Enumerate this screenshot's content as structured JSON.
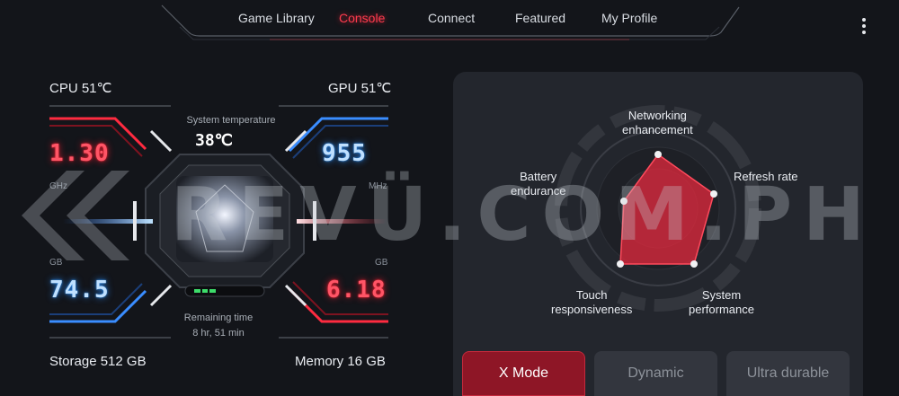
{
  "nav": {
    "tabs": [
      {
        "label": "Game Library",
        "active": false
      },
      {
        "label": "Console",
        "active": true
      },
      {
        "label": "Connect",
        "active": false
      },
      {
        "label": "Featured",
        "active": false
      },
      {
        "label": "My Profile",
        "active": false
      }
    ],
    "menu_icon": "more-vertical-icon"
  },
  "dashboard": {
    "cpu_label": "CPU  51℃",
    "gpu_label": "GPU  51℃",
    "system_temp_label": "System temperature",
    "system_temp_value": "38℃",
    "cpu_freq": "1.30",
    "cpu_freq_unit": "GHz",
    "gpu_freq": "955",
    "gpu_freq_unit": "MHz",
    "storage_used": "74.5",
    "storage_unit": "GB",
    "memory_used": "6.18",
    "memory_unit": "GB",
    "remaining_time_label": "Remaining time",
    "remaining_time_value": "8 hr, 51 min",
    "storage_label": "Storage  512 GB",
    "memory_label": "Memory  16 GB",
    "battery_bars": 3
  },
  "performance": {
    "radar_labels": {
      "networking": "Networking\nenhancement",
      "refresh": "Refresh rate",
      "system": "System\nperformance",
      "touch": "Touch\nresponsiveness",
      "battery": "Battery\nendurance"
    },
    "modes": [
      {
        "label": "X Mode",
        "active": true
      },
      {
        "label": "Dynamic",
        "active": false
      },
      {
        "label": "Ultra durable",
        "active": false
      }
    ]
  },
  "watermark": "REVÜ.COM.PH",
  "colors": {
    "accent_red": "#ff3b4e",
    "accent_blue": "#3a8dff",
    "panel": "#23262d",
    "bg": "#13151a"
  }
}
